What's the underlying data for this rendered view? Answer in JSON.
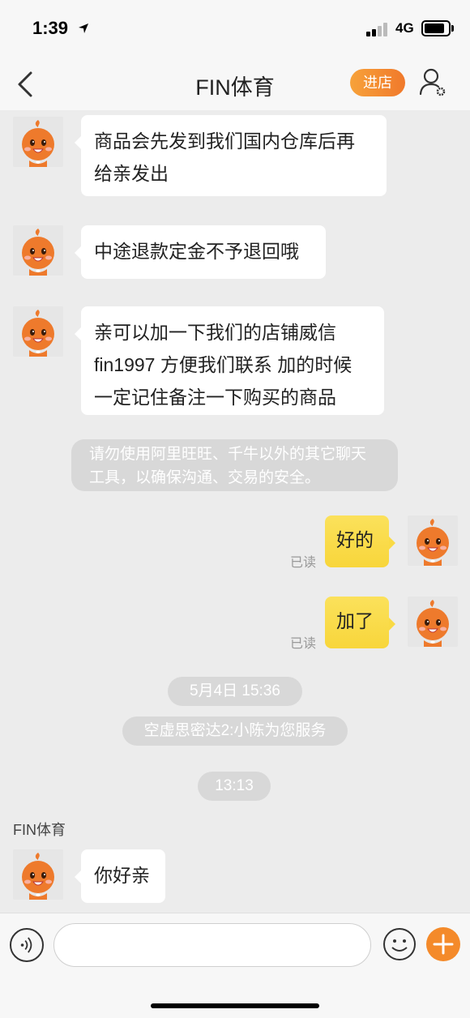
{
  "status_bar": {
    "time": "1:39",
    "network": "4G"
  },
  "nav": {
    "title": "FIN体育",
    "shop_button": "进店"
  },
  "messages": [
    {
      "side": "left",
      "lines": [
        "商品会先发到我们国内仓库后再",
        "给亲发出"
      ]
    },
    {
      "side": "left",
      "lines": [
        "中途退款定金不予退回哦"
      ]
    },
    {
      "side": "left",
      "lines": [
        "亲可以加一下我们的店铺威信",
        "fin1997 方便我们联系 加的时候",
        "一定记住备注一下购买的商品"
      ]
    },
    {
      "side": "right",
      "text": "好的",
      "status": "已读"
    },
    {
      "side": "right",
      "text": "加了",
      "status": "已读"
    },
    {
      "side": "left",
      "text": "你好亲"
    }
  ],
  "system_notice": {
    "lines": [
      "请勿使用阿里旺旺、千牛以外的其它聊天",
      "工具，以确保沟通、交易的安全。"
    ]
  },
  "timestamps": [
    "5月4日 15:36",
    "13:13"
  ],
  "service_notice": "空虚思密达2:小陈为您服务",
  "sender_name": "FIN体育",
  "colors": {
    "accent": "#f0792b",
    "my_bubble": "#f9da45",
    "bg": "#ececec"
  },
  "icons": [
    "back-chevron-icon",
    "profile-settings-icon",
    "voice-icon",
    "emoji-icon",
    "plus-icon",
    "location-arrow-icon"
  ]
}
